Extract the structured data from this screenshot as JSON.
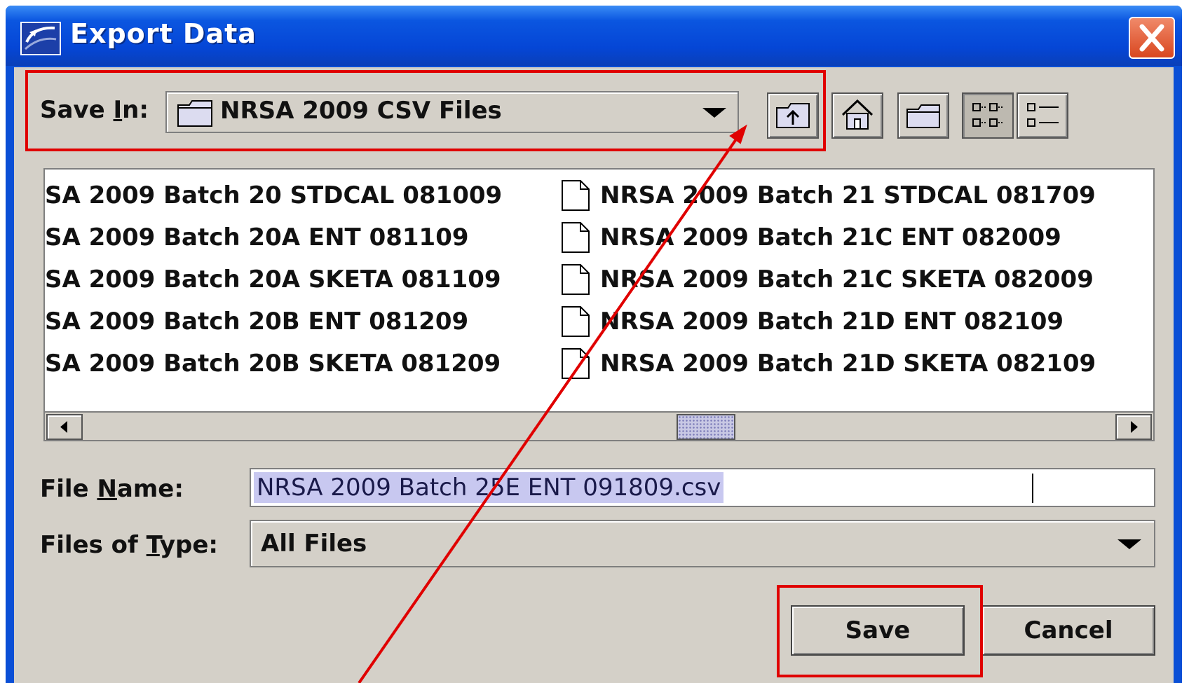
{
  "window": {
    "title": "Export Data"
  },
  "toolbar": {
    "save_in_label_pre": "Save ",
    "save_in_label_ul": "I",
    "save_in_label_post": "n:",
    "save_in_value": "NRSA 2009 CSV Files"
  },
  "files": {
    "left": [
      "SA 2009 Batch 20 STDCAL 081009",
      "SA 2009 Batch 20A ENT 081109",
      "SA 2009 Batch 20A SKETA 081109",
      "SA 2009 Batch 20B ENT 081209",
      "SA 2009 Batch 20B SKETA 081209"
    ],
    "right": [
      "NRSA 2009 Batch 21 STDCAL 081709",
      "NRSA 2009 Batch 21C ENT 082009",
      "NRSA 2009 Batch 21C SKETA 082009",
      "NRSA 2009 Batch 21D ENT 082109",
      "NRSA 2009 Batch 21D SKETA 082109"
    ]
  },
  "filename": {
    "label_pre": "File ",
    "label_ul": "N",
    "label_post": "ame:",
    "value": "NRSA 2009 Batch 25E ENT 091809.csv"
  },
  "filetype": {
    "label_pre": "Files of ",
    "label_ul": "T",
    "label_post": "ype:",
    "value": "All Files"
  },
  "buttons": {
    "save": "Save",
    "cancel": "Cancel"
  },
  "scroll_position": 0.6,
  "colors": {
    "titlebar": "#0546d6",
    "dialog_bg": "#d4d0c8",
    "annotation": "#e00000",
    "selection": "#c8c8f0"
  }
}
